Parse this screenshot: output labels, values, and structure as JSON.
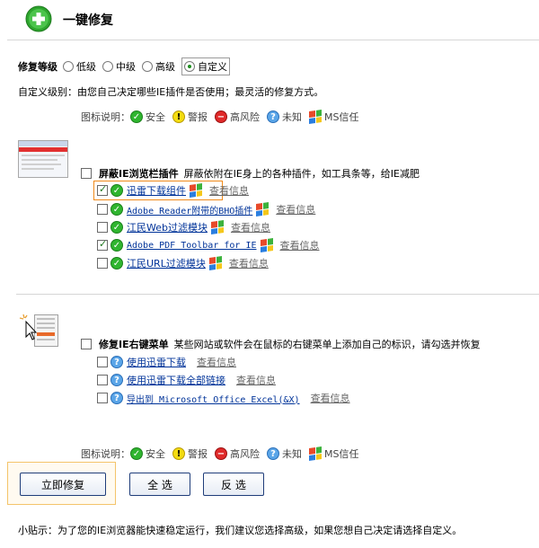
{
  "header": {
    "title": "一键修复"
  },
  "level": {
    "label": "修复等级",
    "options": [
      "低级",
      "中级",
      "高级",
      "自定义"
    ],
    "selected": "自定义"
  },
  "description": "自定义级别：由您自己决定哪些IE插件是否使用；最灵活的修复方式。",
  "legend": {
    "prefix": "图标说明：",
    "items": [
      "安全",
      "警报",
      "高风险",
      "未知",
      "MS信任"
    ]
  },
  "toolbar_section": {
    "title": "屏蔽IE浏览栏插件",
    "subtitle": "屏蔽依附在IE身上的各种插件，如工具条等，给IE减肥",
    "checked": false,
    "items": [
      {
        "name": "迅雷下载组件",
        "checked": true,
        "status": "safe",
        "info": "查看信息"
      },
      {
        "name": "Adobe Reader附带的BHO插件",
        "checked": false,
        "status": "safe",
        "info": "查看信息"
      },
      {
        "name": "江民Web过滤模块",
        "checked": false,
        "status": "safe",
        "info": "查看信息"
      },
      {
        "name": "Adobe PDF Toolbar for IE",
        "checked": true,
        "status": "safe",
        "info": "查看信息"
      },
      {
        "name": "江民URL过滤模块",
        "checked": false,
        "status": "safe",
        "info": "查看信息"
      }
    ]
  },
  "context_section": {
    "title": "修复IE右键菜单",
    "subtitle": "某些网站或软件会在鼠标的右键菜单上添加自己的标识，请勾选并恢复",
    "checked": false,
    "items": [
      {
        "name": "使用迅雷下载",
        "checked": false,
        "status": "unknown",
        "info": "查看信息"
      },
      {
        "name": "使用迅雷下载全部链接",
        "checked": false,
        "status": "unknown",
        "info": "查看信息"
      },
      {
        "name": "导出到 Microsoft Office Excel(&X)",
        "checked": false,
        "status": "unknown",
        "info": "查看信息"
      }
    ]
  },
  "buttons": {
    "repair": "立即修复",
    "select_all": "全 选",
    "invert": "反 选"
  },
  "tip": "小贴示：为了您的IE浏览器能快速稳定运行，我们建议您选择高级，如果您想自己决定请选择自定义。",
  "colors": {
    "safe": "#2fb52f",
    "warning": "#f4dc12",
    "risk": "#e02a2a",
    "unknown": "#5aa5e8",
    "link": "#003399",
    "highlight": "#f08a1a"
  },
  "icons": {
    "header": "green-plus-icon",
    "safe": "check-circle-icon",
    "warning": "exclamation-circle-icon",
    "risk": "minus-circle-icon",
    "unknown": "question-circle-icon",
    "ms": "windows-logo-icon"
  }
}
